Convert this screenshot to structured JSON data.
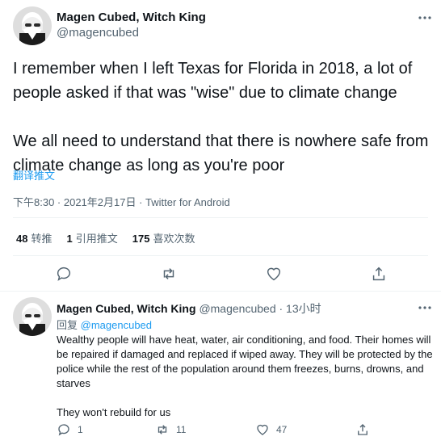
{
  "tweet": {
    "author_name": "Magen Cubed, Witch King",
    "author_handle": "@magencubed",
    "text": "I remember when I left Texas for Florida in 2018, a lot of people asked if that was \"wise\" due to climate change\n\nWe all need to understand that there is nowhere safe from climate change as long as you're poor",
    "translate_label": "翻译推文",
    "timestamp": "下午8:30 · 2021年2月17日 · Twitter for Android",
    "stats": {
      "retweets_count": "48",
      "retweets_label": "转推",
      "quotes_count": "1",
      "quotes_label": "引用推文",
      "likes_count": "175",
      "likes_label": "喜欢次数"
    }
  },
  "reply": {
    "author_name": "Magen Cubed, Witch King",
    "author_handle": "@magencubed",
    "time": "· 13小时",
    "reply_prefix": "回复",
    "reply_to": "@magencubed",
    "text": "Wealthy people will have heat, water, air conditioning, and food. Their homes will be repaired if damaged and replaced if wiped away. They will be protected by the police while the rest of the population around them freezes, burns, drowns, and starves\n\nThey won't rebuild for us",
    "reply_count": "1",
    "retweet_count": "11",
    "like_count": "47"
  },
  "colors": {
    "accent": "#1d9bf0",
    "secondary_text": "#536471",
    "divider": "#eff3f4"
  },
  "icons": [
    "more-icon",
    "reply-icon",
    "retweet-icon",
    "like-icon",
    "share-icon"
  ]
}
